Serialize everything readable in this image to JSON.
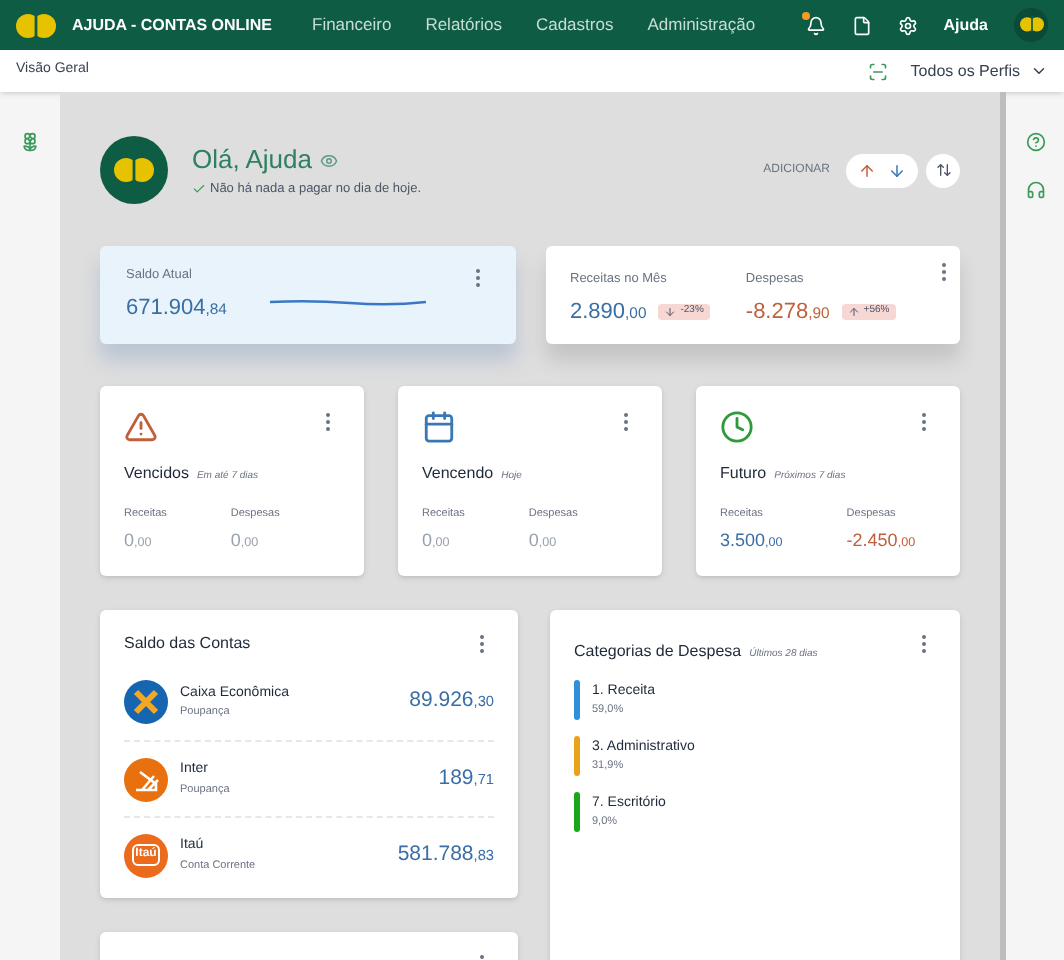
{
  "app": {
    "title": "AJUDA - CONTAS ONLINE",
    "user": "Ajuda",
    "notification": true
  },
  "nav": [
    {
      "label": "Financeiro"
    },
    {
      "label": "Relatórios"
    },
    {
      "label": "Cadastros"
    },
    {
      "label": "Administração"
    }
  ],
  "subheader": {
    "breadcrumb": "Visão Geral",
    "profile": "Todos os Perfis"
  },
  "greeting": {
    "title": "Olá, Ajuda",
    "message": "Não há nada a pagar no dia de hoje.",
    "add_label": "ADICIONAR"
  },
  "balance": {
    "label": "Saldo Atual",
    "value": "671.904",
    "cents": ",84"
  },
  "month": [
    {
      "label": "Receitas no Mês",
      "value": "2.890",
      "cents": ",00",
      "kind": "income",
      "change": {
        "text": "-23%",
        "kind": "down"
      }
    },
    {
      "label": "Despesas",
      "value": "-8.278",
      "cents": ",90",
      "kind": "expense",
      "change": {
        "text": "+56%",
        "kind": "up"
      }
    }
  ],
  "status_cards": [
    {
      "kind": "overdue",
      "title": "Vencidos",
      "subtitle": "Em até 7 dias",
      "income_label": "Receitas",
      "income": "0",
      "income_cents": ",00",
      "expense_label": "Despesas",
      "expense": "0",
      "expense_cents": ",00"
    },
    {
      "kind": "due",
      "title": "Vencendo",
      "subtitle": "Hoje",
      "income_label": "Receitas",
      "income": "0",
      "income_cents": ",00",
      "expense_label": "Despesas",
      "expense": "0",
      "expense_cents": ",00"
    },
    {
      "kind": "future",
      "title": "Futuro",
      "subtitle": "Próximos 7 dias",
      "income_label": "Receitas",
      "income": "3.500",
      "income_cents": ",00",
      "expense_label": "Despesas",
      "expense": "-2.450",
      "expense_cents": ",00"
    }
  ],
  "accounts": {
    "title": "Saldo das Contas",
    "items": [
      {
        "kind": "caixa",
        "name": "Caixa Econômica",
        "type": "Poupança",
        "value": "89.926",
        "cents": ",30"
      },
      {
        "kind": "inter",
        "name": "Inter",
        "type": "Poupança",
        "value": "189",
        "cents": ",71"
      },
      {
        "kind": "itau",
        "name": "Itaú",
        "type": "Conta Corrente",
        "value": "581.788",
        "cents": ",83",
        "logo_text": "Itaú"
      }
    ]
  },
  "categories": {
    "title": "Categorias de Despesa",
    "subtitle": "Últimos 28 dias",
    "items": [
      {
        "name": "1. Receita",
        "share": "59,0%",
        "color": "#2f8fd8"
      },
      {
        "name": "3. Administrativo",
        "share": "31,9%",
        "color": "#e8a31a"
      },
      {
        "name": "7. Escritório",
        "share": "9,0%",
        "color": "#1aa61a"
      }
    ]
  }
}
